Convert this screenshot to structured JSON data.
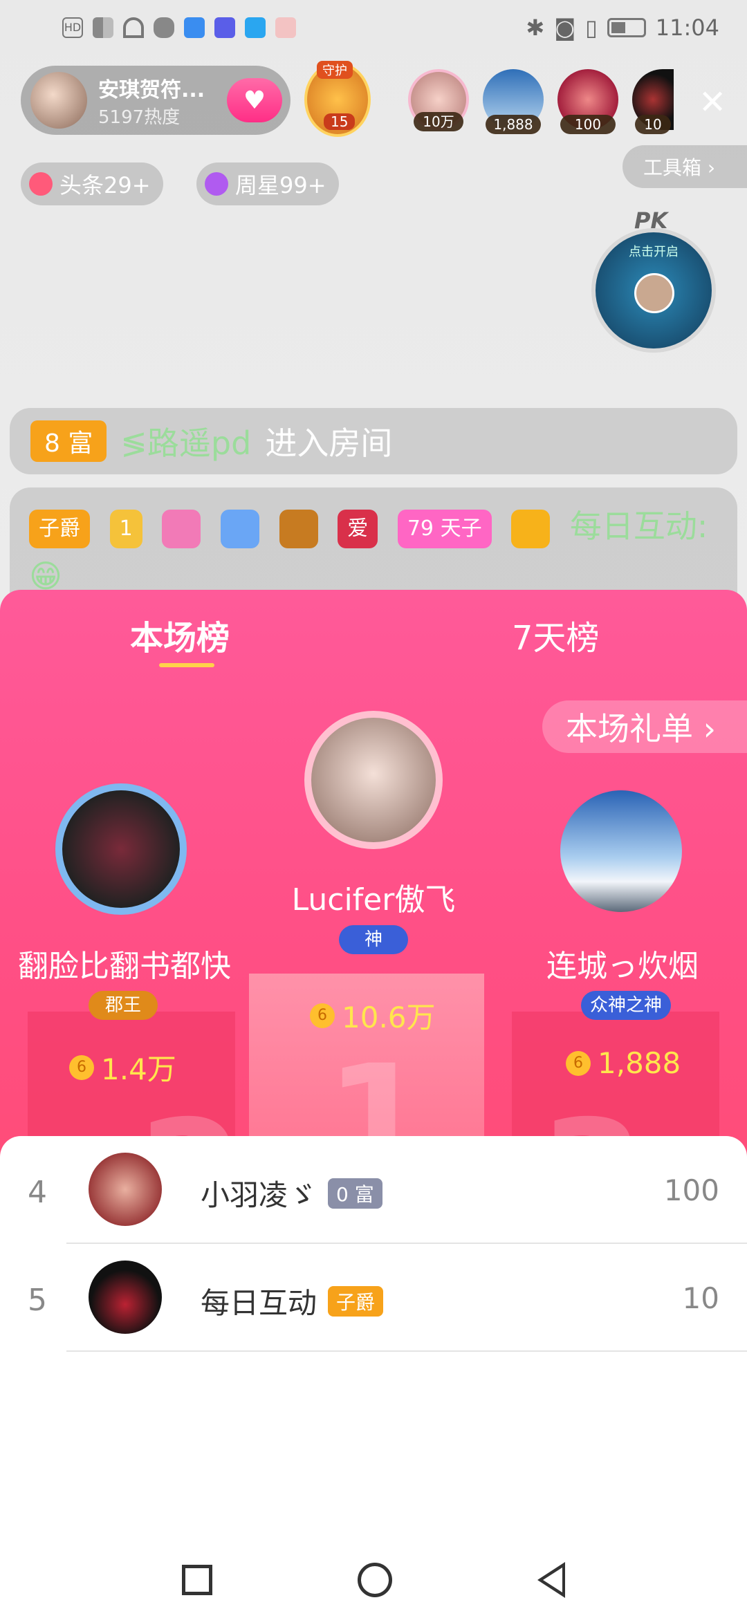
{
  "status_bar": {
    "left_icons": [
      "hd-icon",
      "4g-icon",
      "signal-icon",
      "wifi-icon",
      "shield-icon",
      "cloud-icon",
      "grad-icon",
      "search-icon",
      "calendar-icon"
    ],
    "time": "11:04"
  },
  "host": {
    "name": "安琪贺符...",
    "heat": "5197热度"
  },
  "guard": {
    "label": "守护",
    "count": "15"
  },
  "viewers": [
    {
      "count": "10万"
    },
    {
      "count": "1,888"
    },
    {
      "count": "100"
    },
    {
      "count": "10"
    }
  ],
  "toolbox": {
    "label": "工具箱 ›"
  },
  "chips": [
    {
      "label": "头条29+"
    },
    {
      "label": "周星99+"
    }
  ],
  "pk": {
    "title": "PK",
    "sub": "点击开启"
  },
  "chat": {
    "line1": {
      "badge": "8 富",
      "user": "≶路遥pd",
      "msg": "进入房间"
    },
    "line2": {
      "badges": [
        "子爵",
        "1",
        "爱",
        "79",
        "天子"
      ],
      "user": "每日互动:",
      "emoji": "😁"
    }
  },
  "leaderboard": {
    "tabs": [
      "本场榜",
      "7天榜"
    ],
    "gift_list_label": "本场礼单 ›",
    "top3": [
      {
        "rank_num": "1",
        "name": "Lucifer傲飞",
        "title": "神",
        "coins": "10.6万"
      },
      {
        "rank_num": "2",
        "name": "翻脸比翻书都快",
        "title": "郡王",
        "coins": "1.4万"
      },
      {
        "rank_num": "3",
        "name": "连城っ炊烟",
        "title": "众神之神",
        "coins": "1,888"
      }
    ],
    "rows": [
      {
        "rank": "4",
        "name": "小羽凌ゞ",
        "badge": "0 富",
        "value": "100"
      },
      {
        "rank": "5",
        "name": "每日互动",
        "badge": "子爵",
        "value": "10"
      }
    ]
  },
  "colors": {
    "accent": "#ff4f85",
    "coin": "#ffe64d",
    "tab_underline": "#ffd24a"
  }
}
